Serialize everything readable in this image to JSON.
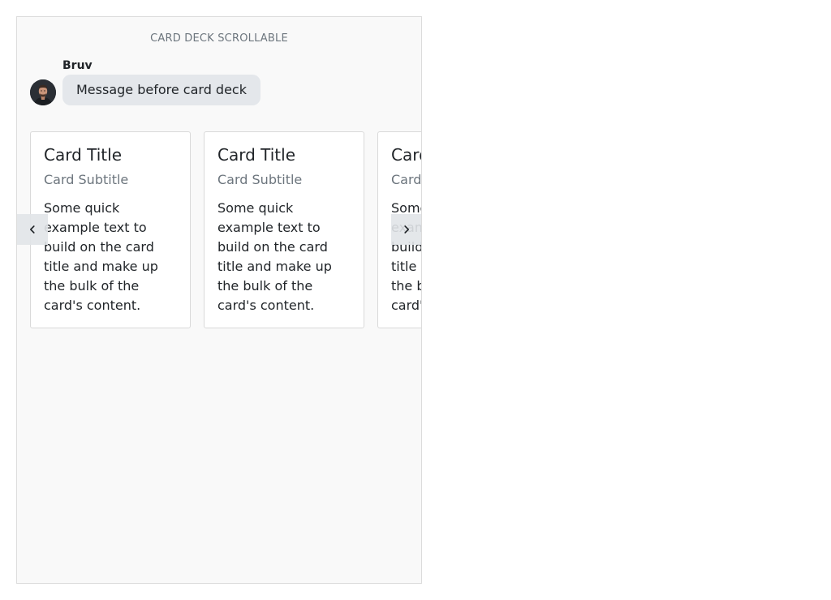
{
  "header": {
    "title": "CARD DECK SCROLLABLE"
  },
  "message": {
    "sender": "Bruv",
    "text": "Message before card deck",
    "avatar_icon": "user-avatar"
  },
  "deck": {
    "cards": [
      {
        "title": "Card Title",
        "subtitle": "Card Subtitle",
        "text": "Some quick example text to build on the card title and make up the bulk of the card's content."
      },
      {
        "title": "Card Title",
        "subtitle": "Card Subtitle",
        "text": "Some quick example text to build on the card title and make up the bulk of the card's content."
      },
      {
        "title": "Card Title",
        "subtitle": "Card Subtitle",
        "text": "Some quick example text to build on the card title and make up the bulk of the card's content."
      }
    ],
    "prev_icon": "chevron-left-icon",
    "next_icon": "chevron-right-icon"
  },
  "colors": {
    "background": "#f9f9f9",
    "bubble": "#e4e7eb",
    "muted_text": "#6c757d",
    "text": "#212529",
    "card_border": "#d9d9d9"
  }
}
